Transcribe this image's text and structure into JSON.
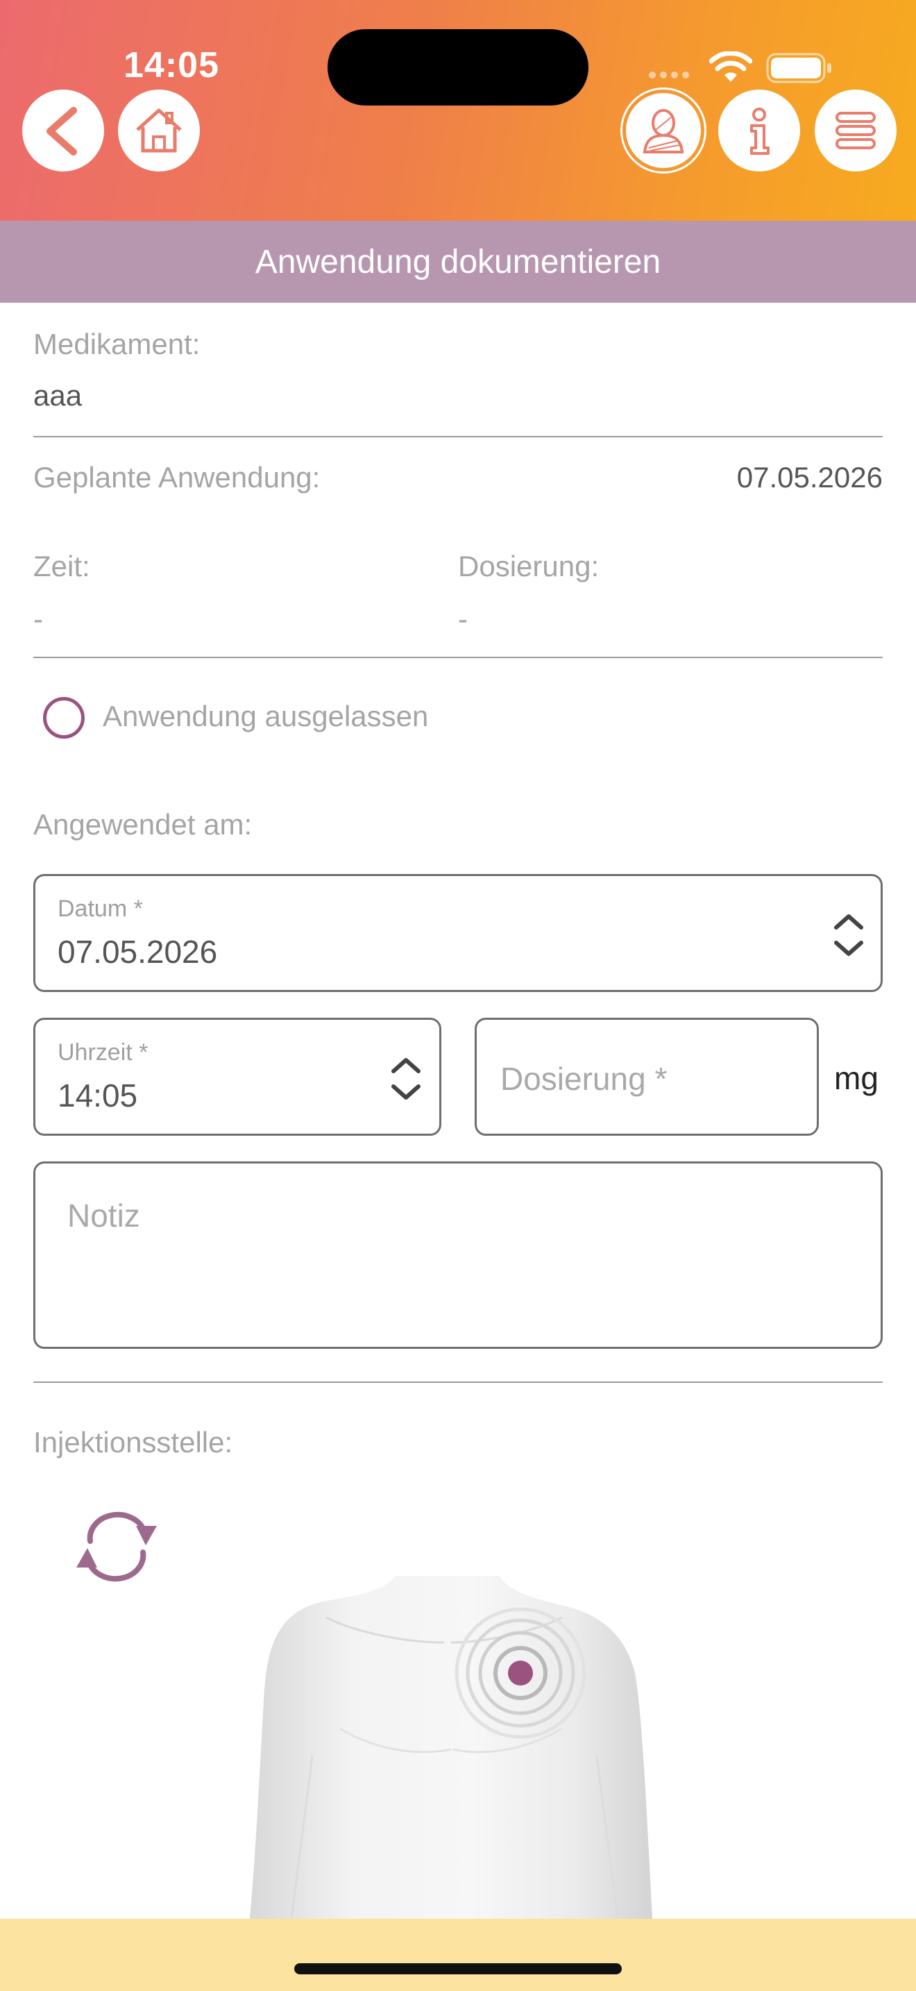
{
  "status_bar": {
    "time": "14:05"
  },
  "header": {
    "back_icon": "back-arrow-icon",
    "home_icon": "home-icon",
    "profile_icon": "user-icon",
    "info_icon": "info-icon",
    "menu_icon": "menu-icon"
  },
  "title": "Anwendung dokumentieren",
  "medication": {
    "label": "Medikament:",
    "value": "aaa"
  },
  "planned": {
    "label": "Geplante Anwendung:",
    "value": "07.05.2026"
  },
  "time_info": {
    "label": "Zeit:",
    "value": "-"
  },
  "dose_info": {
    "label": "Dosierung:",
    "value": "-"
  },
  "skipped": {
    "label": "Anwendung ausgelassen",
    "checked": false
  },
  "applied_on": {
    "label": "Angewendet am:"
  },
  "date_field": {
    "label": "Datum *",
    "value": "07.05.2026"
  },
  "time_field": {
    "label": "Uhrzeit *",
    "value": "14:05"
  },
  "dose_field": {
    "placeholder": "Dosierung *",
    "unit": "mg"
  },
  "note_field": {
    "placeholder": "Notiz"
  },
  "injection": {
    "label": "Injektionsstelle:",
    "rotate_icon": "rotate-icon",
    "target_icon": "target-icon"
  },
  "colors": {
    "accent": "#9c527f",
    "title_bar": "#b797af",
    "header_start": "#ec6a6e",
    "header_end": "#f7ab1f",
    "bottom_bar": "#fce39f"
  }
}
